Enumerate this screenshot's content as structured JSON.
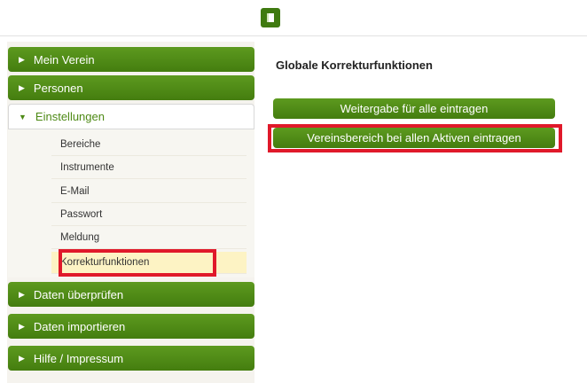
{
  "toolbar": {
    "icon": "book-icon"
  },
  "sidebar": {
    "mein_verein": "Mein Verein",
    "personen": "Personen",
    "einstellungen": "Einstellungen",
    "sub_items": [
      "Bereiche",
      "Instrumente",
      "E-Mail",
      "Passwort",
      "Meldung",
      "Korrekturfunktionen"
    ],
    "active_item": "Korrekturfunktionen",
    "daten_pruefen": "Daten überprüfen",
    "daten_importieren": "Daten importieren",
    "hilfe": "Hilfe / Impressum"
  },
  "main": {
    "title": "Globale Korrekturfunktionen",
    "btn_weitergabe": "Weitergabe für alle eintragen",
    "btn_vereinsbereich": "Vereinsbereich bei allen Aktiven eintragen"
  },
  "colors": {
    "accent": "#4e8a16",
    "highlight": "#e0192a",
    "active_bg": "#fdf3c4"
  }
}
